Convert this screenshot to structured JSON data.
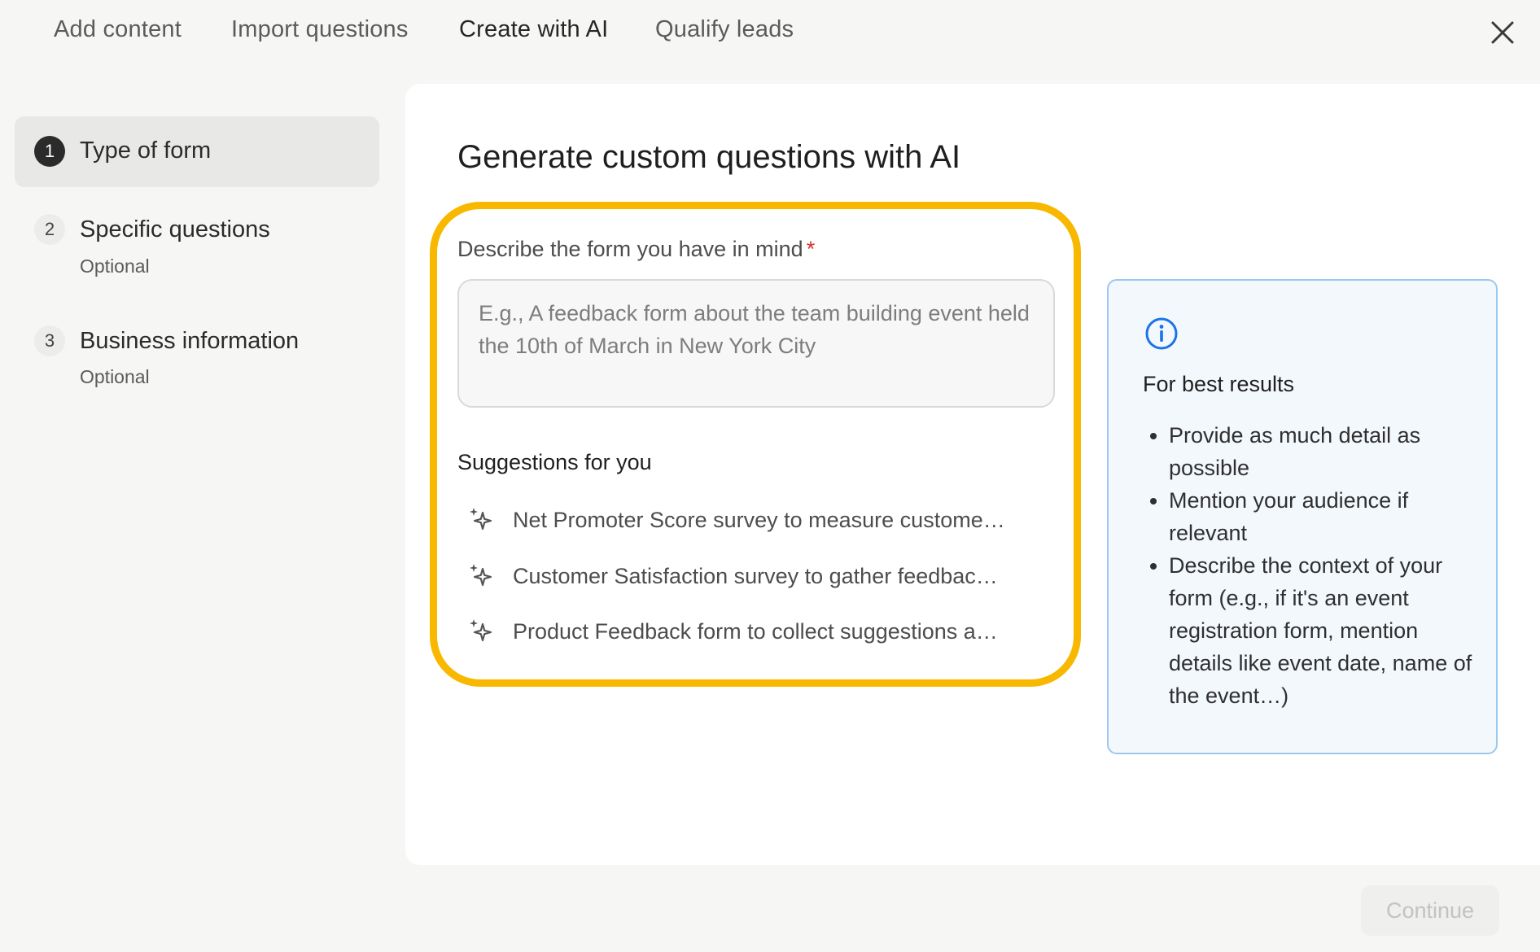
{
  "tabs": [
    {
      "label": "Add content"
    },
    {
      "label": "Import questions"
    },
    {
      "label": "Create with AI"
    },
    {
      "label": "Qualify leads"
    }
  ],
  "steps": [
    {
      "number": "1",
      "title": "Type of form",
      "subtitle": ""
    },
    {
      "number": "2",
      "title": "Specific questions",
      "subtitle": "Optional"
    },
    {
      "number": "3",
      "title": "Business information",
      "subtitle": "Optional"
    }
  ],
  "main": {
    "title": "Generate custom questions with AI",
    "field_label": "Describe the form you have in mind",
    "required_mark": "*",
    "placeholder": "E.g., A feedback form about the team building event held the 10th of March in New York City",
    "value": "",
    "suggestions_heading": "Suggestions for you",
    "suggestions": [
      "Net Promoter Score survey to measure custome…",
      "Customer Satisfaction survey to gather feedbac…",
      "Product Feedback form to collect suggestions a…"
    ]
  },
  "info": {
    "icon": "info-icon",
    "title": "For best results",
    "tips": [
      "Provide as much detail as possible",
      "Mention your audience if relevant",
      "Describe the context of your form (e.g., if it's an event registration form, mention details like event date, name of the event…)"
    ]
  },
  "footer": {
    "continue_label": "Continue",
    "continue_enabled": false
  },
  "colors": {
    "highlight": "#f8b800",
    "info_border": "#9ec7ef",
    "info_bg": "#f3f8fd",
    "info_icon": "#1a73e8",
    "required": "#d93025"
  }
}
